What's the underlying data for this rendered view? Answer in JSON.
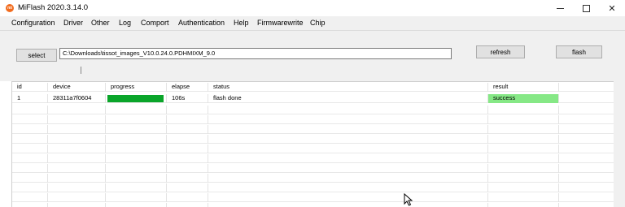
{
  "window": {
    "title": "MiFlash 2020.3.14.0",
    "app_icon_text": "mi",
    "minimize_glyph": "—",
    "maximize_glyph": "☐",
    "close_glyph": "✕"
  },
  "menu": [
    "Configuration",
    "Driver",
    "Other",
    "Log",
    "Comport",
    "Authentication",
    "Help",
    "Firmwarewrite",
    "Chip"
  ],
  "toolbar": {
    "select_label": "select",
    "path_value": "C:\\Downloads\\tissot_images_V10.0.24.0.PDHMIXM_9.0",
    "refresh_label": "refresh",
    "flash_label": "flash"
  },
  "table": {
    "headers": {
      "id": "id",
      "device": "device",
      "progress": "progress",
      "elapse": "elapse",
      "status": "status",
      "result": "result"
    },
    "rows": [
      {
        "id": "1",
        "device": "28311a7f0604",
        "progress": 1.0,
        "elapse": "106s",
        "status": "flash done",
        "result": "success"
      }
    ]
  },
  "colors": {
    "progress": "#0aa52a",
    "success": "#86e886",
    "app_icon": "#f26b1d"
  }
}
